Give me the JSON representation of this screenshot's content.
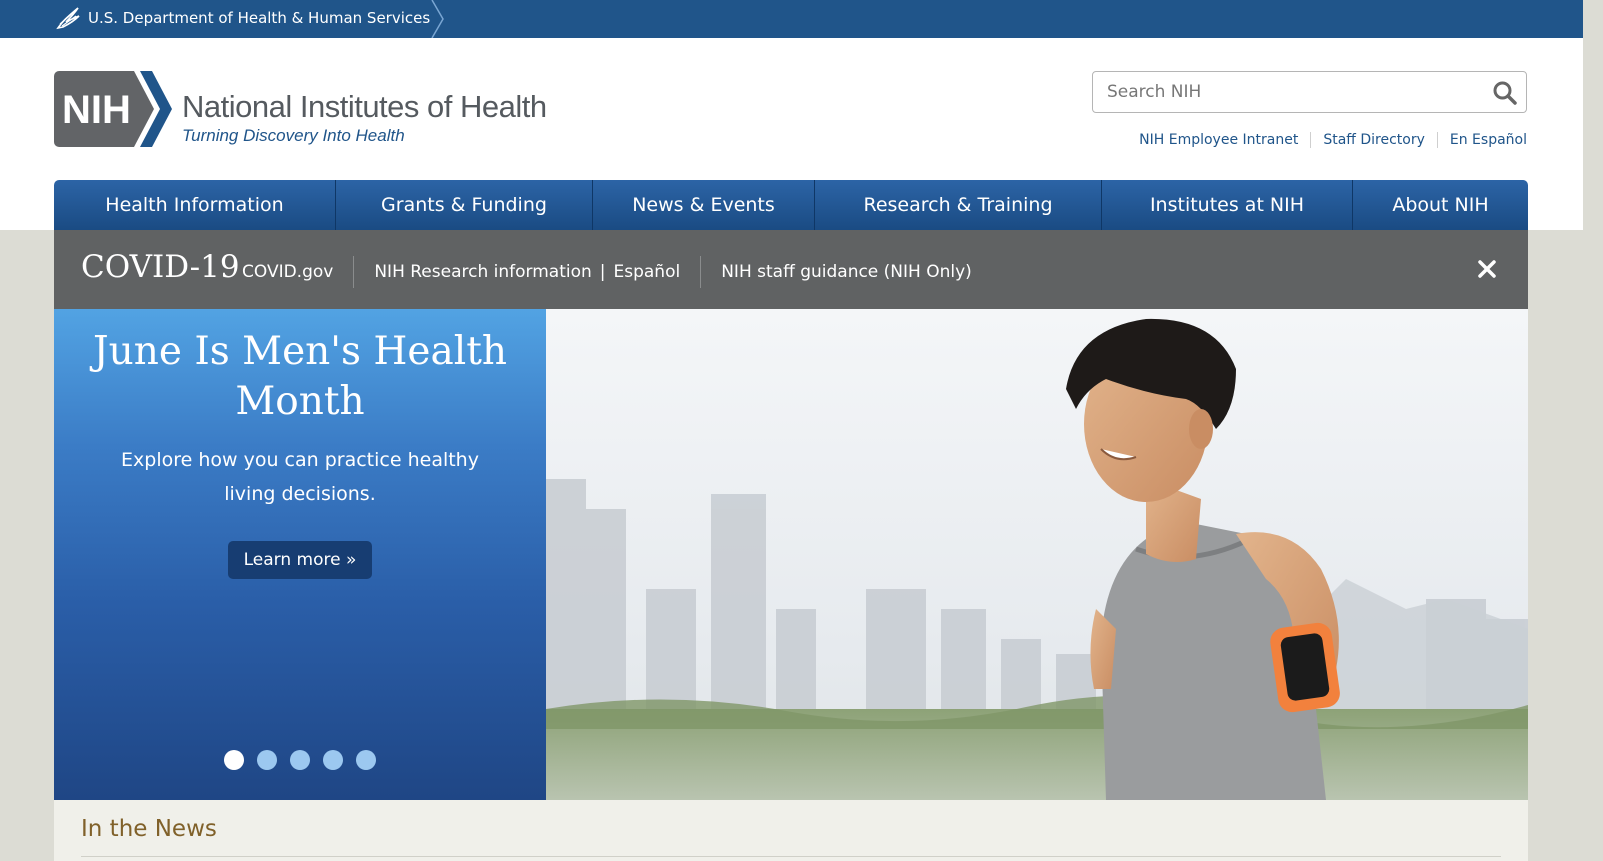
{
  "hhs_bar": {
    "label": "U.S. Department of Health & Human Services",
    "color": "#20558a"
  },
  "header": {
    "logo_mark": "NIH",
    "org_name": "National Institutes of Health",
    "tagline": "Turning Discovery Into Health",
    "search": {
      "placeholder": "Search NIH",
      "value": ""
    },
    "utility_links": [
      {
        "label": "NIH Employee Intranet"
      },
      {
        "label": "Staff Directory"
      },
      {
        "label": "En Español"
      }
    ]
  },
  "nav": {
    "items": [
      {
        "label": "Health Information"
      },
      {
        "label": "Grants & Funding"
      },
      {
        "label": "News & Events"
      },
      {
        "label": "Research & Training"
      },
      {
        "label": "Institutes at NIH"
      },
      {
        "label": "About NIH"
      }
    ]
  },
  "covid_banner": {
    "title": "COVID-19",
    "links": {
      "covid_gov": "COVID.gov",
      "research_info": "NIH Research information",
      "pipe": "|",
      "espanol": "Español",
      "staff_guidance": "NIH staff guidance (NIH Only)"
    },
    "close_icon": "close-icon"
  },
  "hero": {
    "title": "June Is Men's Health Month",
    "description": "Explore how you can practice healthy living decisions.",
    "button_label": "Learn more »",
    "slide_count": 5,
    "active_slide": 1
  },
  "news": {
    "title": "In the News"
  },
  "colors": {
    "brand_blue": "#20558a",
    "covid_gray": "#606263",
    "news_heading": "#80612a"
  }
}
